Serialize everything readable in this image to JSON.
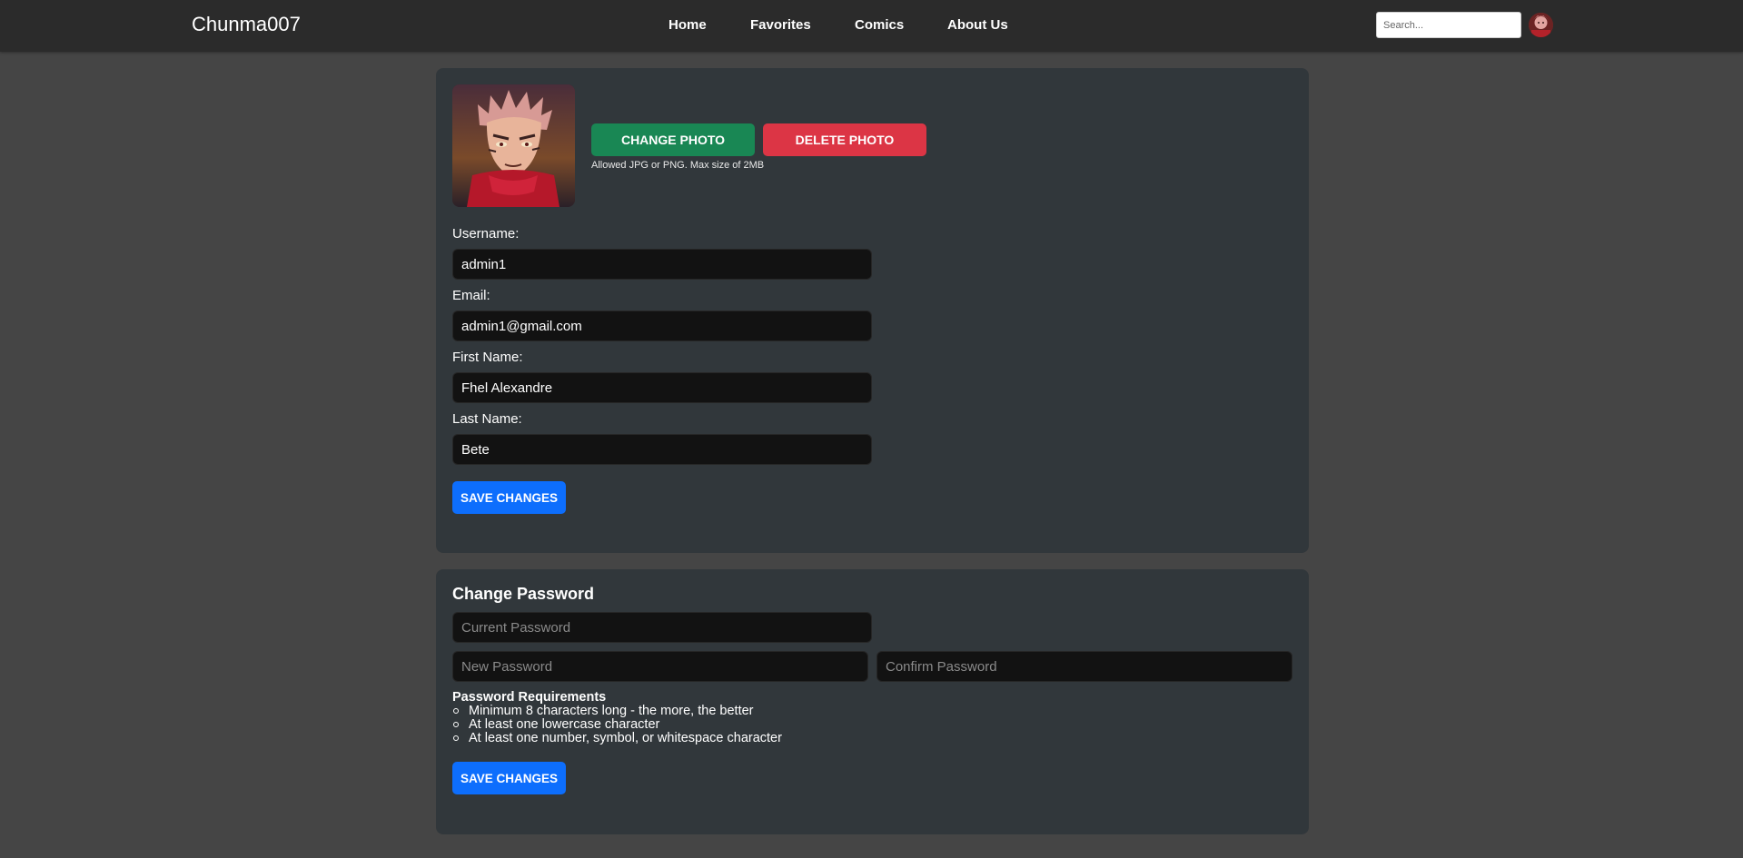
{
  "nav": {
    "brand": "Chunma007",
    "links": [
      "Home",
      "Favorites",
      "Comics",
      "About Us"
    ],
    "search_placeholder": "Search..."
  },
  "profile": {
    "change_photo": "CHANGE PHOTO",
    "delete_photo": "DELETE PHOTO",
    "photo_hint": "Allowed JPG or PNG. Max size of 2MB",
    "fields": [
      {
        "label": "Username:",
        "value": "admin1"
      },
      {
        "label": "Email:",
        "value": "admin1@gmail.com"
      },
      {
        "label": "First Name:",
        "value": "Fhel Alexandre"
      },
      {
        "label": "Last Name:",
        "value": "Bete"
      }
    ],
    "save": "SAVE CHANGES"
  },
  "password": {
    "title": "Change Password",
    "current_placeholder": "Current Password",
    "new_placeholder": "New Password",
    "confirm_placeholder": "Confirm Password",
    "requirements_title": "Password Requirements",
    "requirements": [
      "Minimum 8 characters long - the more, the better",
      "At least one lowercase character",
      "At least one number, symbol, or whitespace character"
    ],
    "save": "SAVE CHANGES"
  },
  "colors": {
    "success": "#198754",
    "danger": "#dc3545",
    "primary": "#0d6efd"
  }
}
